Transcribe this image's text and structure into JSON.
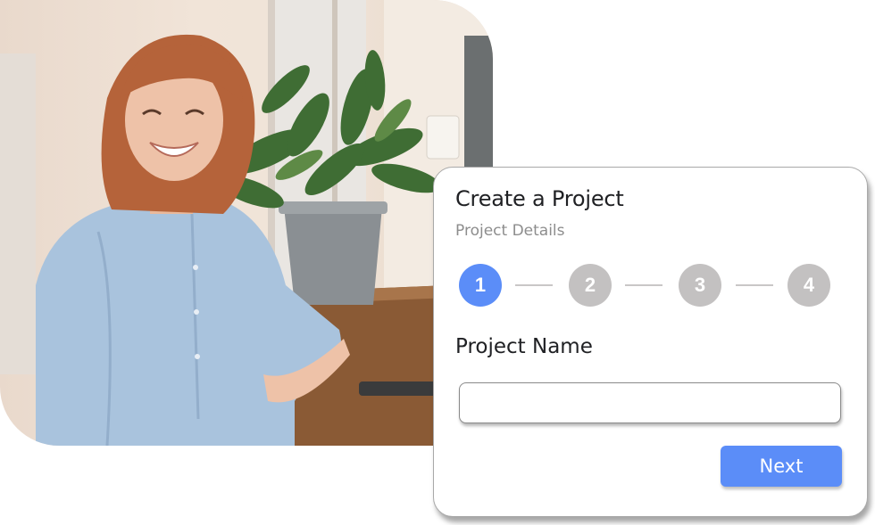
{
  "photo": {
    "subject": "smiling-woman-with-plant",
    "colors": {
      "wall": "#efe3d7",
      "window": "#e8e2dc",
      "shirt": "#a9c3dd",
      "hair": "#b5633a",
      "skin": "#eec2a8",
      "leaves": "#3f6d34",
      "pot": "#8a8f93",
      "table": "#8a5a35"
    }
  },
  "card": {
    "title": "Create a Project",
    "subtitle": "Project Details",
    "steps": [
      {
        "number": "1",
        "active": true
      },
      {
        "number": "2",
        "active": false
      },
      {
        "number": "3",
        "active": false
      },
      {
        "number": "4",
        "active": false
      }
    ],
    "field": {
      "label": "Project Name",
      "value": "",
      "placeholder": ""
    },
    "next_label": "Next"
  },
  "colors": {
    "accent": "#5b8df8",
    "step_inactive": "#c3c1c1",
    "title_text": "#202124",
    "subtitle_text": "#8d8d8d"
  }
}
